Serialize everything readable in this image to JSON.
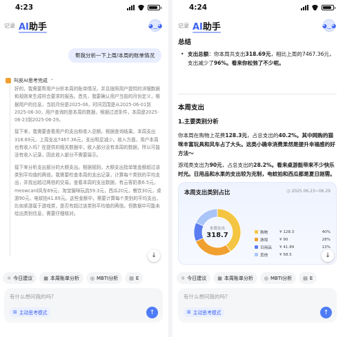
{
  "left": {
    "status": {
      "time": "4:23"
    },
    "header": {
      "record": "记录",
      "brand_ai": "AI",
      "brand_rest": "助手"
    },
    "user_message": "帮我分析一下上周/本周的账单情况",
    "thinking_label": "叫皮AI思考完成",
    "thinking_paragraphs": [
      "好的，我需要帮用户分析本周的账单情况，并且按照用户提供的详细数据和规则来生成符合要求的报告。首先，我要确认用户当前的月份定义，根据用户的信息，当前月份是2025-06，时间范围是从2025-06-01到2025-06-30，用户查询的是本周的数据，根据过滤条件，本周是2025-06-23到2025-06-29。",
      "接下来，我需要查看用户的支出和收入总额。根据查询结果，本周支出318.69元，上周支出7467.36元，支出明显减少。收入方面，用户本周也有收入吗？在提供的相关数据中，收入部分没有本周的数据，所以可能没有收入记录，因此收入部分不需要展示。",
      "接下来分析支出部分的大额支出。根据规则，大额支出指单笔金额超过该类别平均值的两倍。我需要检查本周的支出记录，计算每个类别的平均支出，并找出超过两倍的交易。查看本周的支出数据，有云客奶茶6.5元，meowcard风车69元，淘宝猫咪玩具59.3元，西瓜20元，餐饮30元，桌游90元，电蚊拍41.89元。这些金额中，需要计算每个类别的平均支出，比如桌游属于游戏类，是否有超过该类别平均值的两倍。但数据中可能未给出类别信息，需要仔细核对。"
    ],
    "chips": [
      {
        "icon": "lightbulb-icon",
        "glyph": "☼",
        "label": "今日建议"
      },
      {
        "icon": "calendar-icon",
        "glyph": "▦",
        "label": "本周账单分析"
      },
      {
        "icon": "mbti-icon",
        "glyph": "◎",
        "label": "MBTI分析"
      },
      {
        "icon": "more-icon",
        "glyph": "▤",
        "label": "E"
      }
    ],
    "input_placeholder": "有什么想问我的吗?",
    "mode_label": "主动思考模式"
  },
  "right": {
    "status": {
      "time": "4:24"
    },
    "header": {
      "record": "记录",
      "brand_ai": "AI",
      "brand_rest": "助手"
    },
    "summary_title": "总结",
    "summary": {
      "prefix": "支出总额",
      "text1": "：你本周共支出",
      "amount1": "318.69元",
      "text2": "，相比上周的7467.36元，支出减少了",
      "pct": "96%",
      "text3": "。看来你松弛了不少呢。"
    },
    "section_title": "本周支出",
    "sub_title": "1.主要类别分析",
    "para1": {
      "t1": "你本周在购物上花费",
      "v1": "128.3元",
      "t2": "，占总支出的",
      "v2": "40.2%",
      "t3": "。其中网购的猫咪丰富玩具和风车占了大头。这类小确幸消费果然是提升幸福感的好方法～"
    },
    "para2": {
      "t1": "游戏类支出为",
      "v1": "90元",
      "t2": "，占总支出的",
      "v2": "28.2%",
      "t3": "。看来桌游能带来不少快乐时光。日用品和水果的支出较为克制，电蚊拍和西瓜都是夏日刚需。"
    },
    "card": {
      "title": "本周支出类别占比",
      "date": "2025.06.23~06.29"
    }
  },
  "chart_data": {
    "type": "pie",
    "title": "本周支出类别占比",
    "center_label": "本周支出",
    "center_value": "318.7",
    "categories": [
      "购物",
      "游戏",
      "日用品",
      "其他"
    ],
    "amounts_label": [
      "¥ 128.3",
      "¥ 90",
      "¥ 41.89",
      "¥ 58.5"
    ],
    "values": [
      40,
      28,
      13,
      18
    ],
    "percent_labels": [
      "40%",
      "28%",
      "13%",
      "18%"
    ],
    "colors": [
      "#f4c542",
      "#f0a030",
      "#5b7cf0",
      "#a9c4f7"
    ]
  }
}
